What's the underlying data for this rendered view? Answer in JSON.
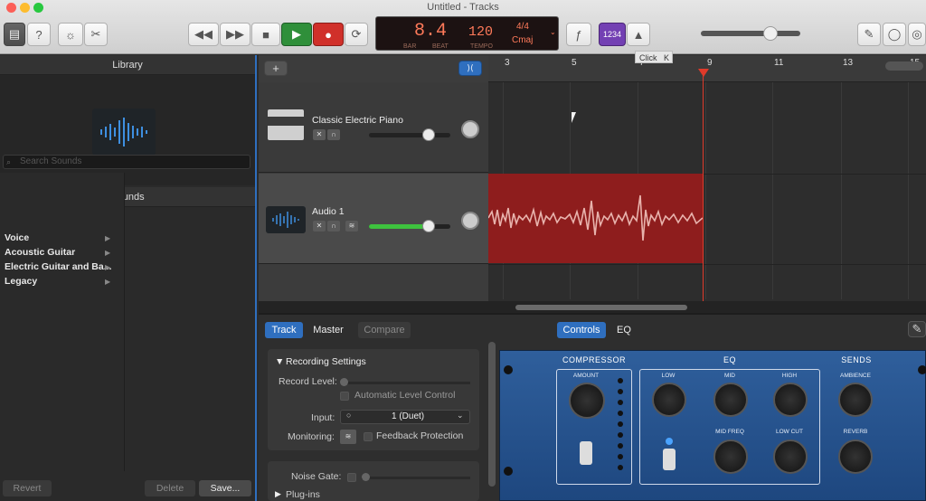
{
  "window": {
    "title": "Untitled - Tracks"
  },
  "lcd": {
    "position": "8.4",
    "pos_bar_label": "BAR",
    "pos_beat_label": "BEAT",
    "tempo": "120",
    "tempo_label": "TEMPO",
    "time_sig": "4/4",
    "key": "Cmaj"
  },
  "count_in": "1234",
  "tooltip": {
    "text": "Click",
    "shortcut": "K"
  },
  "library": {
    "title": "Library",
    "sounds_title": "Sounds",
    "search_placeholder": "Search Sounds",
    "items": [
      "Voice",
      "Acoustic Guitar",
      "Electric Guitar and Ba...",
      "Legacy"
    ],
    "buttons": {
      "revert": "Revert",
      "delete": "Delete",
      "save": "Save..."
    }
  },
  "ruler": {
    "marks": [
      "3",
      "5",
      "7",
      "9",
      "11",
      "13",
      "15"
    ]
  },
  "tracks": [
    {
      "name": "Classic Electric Piano",
      "volume": 0.68
    },
    {
      "name": "Audio 1",
      "volume": 0.68
    }
  ],
  "smart_controls": {
    "tabs_left": [
      "Track",
      "Master",
      "Compare"
    ],
    "tabs_right": [
      "Controls",
      "EQ"
    ],
    "recording_settings": "Recording Settings",
    "record_level": "Record Level:",
    "auto_level": "Automatic Level Control",
    "input_label": "Input:",
    "input_value": "1  (Duet)",
    "monitoring": "Monitoring:",
    "feedback": "Feedback Protection",
    "noise_gate": "Noise Gate:",
    "plugins": "Plug-ins"
  },
  "amp": {
    "compressor": "COMPRESSOR",
    "eq": "EQ",
    "sends": "SENDS",
    "amount": "AMOUNT",
    "low": "LOW",
    "mid": "MID",
    "high": "HIGH",
    "mid_freq": "MID FREQ",
    "low_cut": "LOW CUT",
    "ambience": "AMBIENCE",
    "reverb": "REVERB"
  },
  "colors": {
    "accent": "#2f6fbf",
    "play": "#2f8f3a",
    "record": "#d0302a",
    "region": "#8e1d1d",
    "playhead": "#e03a2a"
  }
}
